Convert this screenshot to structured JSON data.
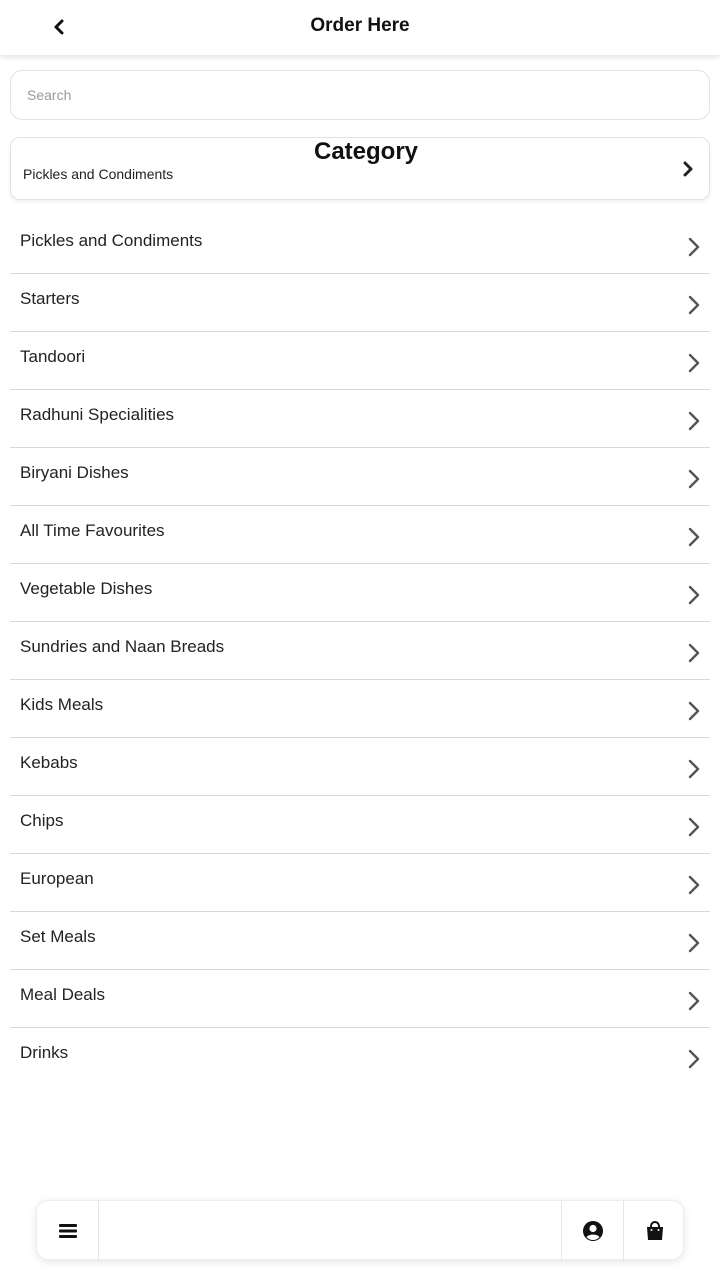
{
  "header": {
    "title": "Order Here",
    "back_icon": "chevron-left-icon"
  },
  "search": {
    "placeholder": "Search",
    "value": ""
  },
  "category": {
    "heading": "Category",
    "selected": "Pickles and Condiments",
    "icon": "chevron-right-icon"
  },
  "categories": [
    "Pickles and Condiments",
    "Starters",
    "Tandoori",
    "Radhuni Specialities",
    "Biryani Dishes",
    "All Time Favourites",
    "Vegetable Dishes",
    "Sundries and Naan Breads",
    "Kids Meals",
    "Kebabs",
    "Chips",
    "European",
    "Set Meals",
    "Meal Deals",
    "Drinks"
  ],
  "bottom_bar": {
    "menu_icon": "hamburger-menu-icon",
    "account_icon": "user-circle-icon",
    "cart_icon": "shopping-bag-icon"
  },
  "colors": {
    "background": "#ffffff",
    "text": "#222222",
    "divider": "#d8d8d8",
    "chevron": "#555555"
  }
}
